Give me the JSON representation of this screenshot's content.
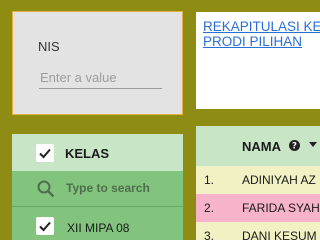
{
  "nis_filter": {
    "label": "NIS",
    "placeholder": "Enter a value"
  },
  "title_card": {
    "line1": "REKAPITULASI KE",
    "line2": "PRODI PILIHAN"
  },
  "kelas_filter": {
    "title": "KELAS",
    "all_checked": true,
    "search_placeholder": "Type to search",
    "options": [
      {
        "label": "XII MIPA 08",
        "checked": true
      }
    ]
  },
  "table": {
    "column_header": "NAMA",
    "rows": [
      {
        "num": "1.",
        "name": "ADINIYAH AZ",
        "bg": "#f2f1c4"
      },
      {
        "num": "2.",
        "name": "FARIDA SYAH",
        "bg": "#f7b3c9"
      },
      {
        "num": "3.",
        "name": "DANI KESUM",
        "bg": "#f2f1c4"
      }
    ]
  },
  "colors": {
    "page_bg": "#8f8c14",
    "link": "#2a6fd6",
    "header_bg": "#c8e5c6",
    "option_bg": "#82c47e"
  }
}
